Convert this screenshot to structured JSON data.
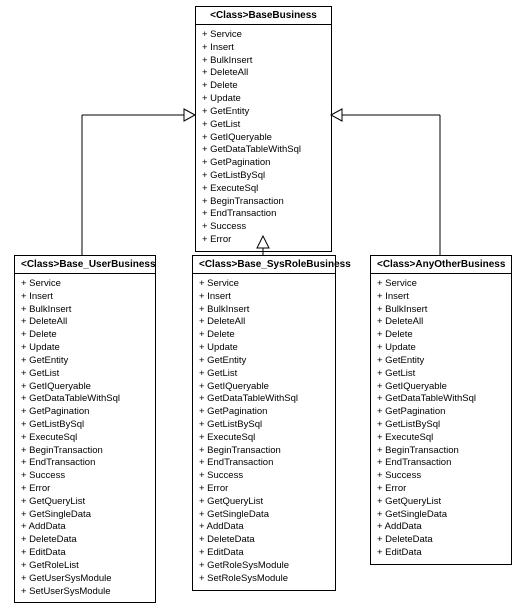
{
  "base": {
    "title": "<Class>BaseBusiness",
    "members": [
      "Service",
      "Insert",
      "BulkInsert",
      "DeleteAll",
      "Delete",
      "Update",
      "GetEntity",
      "GetList",
      "GetIQueryable",
      "GetDataTableWithSql",
      "GetPagination",
      "GetListBySql",
      "ExecuteSql",
      "BeginTransaction",
      "EndTransaction",
      "Success",
      "Error"
    ]
  },
  "user": {
    "title": "<Class>Base_UserBusiness",
    "members": [
      "Service",
      "Insert",
      "BulkInsert",
      "DeleteAll",
      "Delete",
      "Update",
      "GetEntity",
      "GetList",
      "GetIQueryable",
      "GetDataTableWithSql",
      "GetPagination",
      "GetListBySql",
      "ExecuteSql",
      "BeginTransaction",
      "EndTransaction",
      "Success",
      "Error",
      "GetQueryList",
      "GetSingleData",
      "AddData",
      "DeleteData",
      "EditData",
      "GetRoleList",
      "GetUserSysModule",
      "SetUserSysModule"
    ]
  },
  "role": {
    "title": "<Class>Base_SysRoleBusiness",
    "members": [
      "Service",
      "Insert",
      "BulkInsert",
      "DeleteAll",
      "Delete",
      "Update",
      "GetEntity",
      "GetList",
      "GetIQueryable",
      "GetDataTableWithSql",
      "GetPagination",
      "GetListBySql",
      "ExecuteSql",
      "BeginTransaction",
      "EndTransaction",
      "Success",
      "Error",
      "GetQueryList",
      "GetSingleData",
      "AddData",
      "DeleteData",
      "EditData",
      "GetRoleSysModule",
      "SetRoleSysModule"
    ]
  },
  "other": {
    "title": "<Class>AnyOtherBusiness",
    "members": [
      "Service",
      "Insert",
      "BulkInsert",
      "DeleteAll",
      "Delete",
      "Update",
      "GetEntity",
      "GetList",
      "GetIQueryable",
      "GetDataTableWithSql",
      "GetPagination",
      "GetListBySql",
      "ExecuteSql",
      "BeginTransaction",
      "EndTransaction",
      "Success",
      "Error",
      "GetQueryList",
      "GetSingleData",
      "AddData",
      "DeleteData",
      "EditData"
    ]
  }
}
